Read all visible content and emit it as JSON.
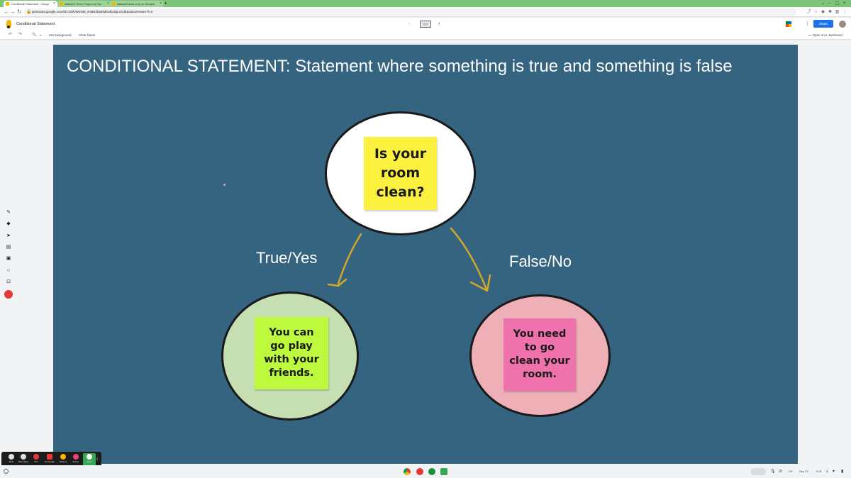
{
  "browser": {
    "tabs": [
      {
        "label": "Conditional Statement - Googl",
        "active": true
      },
      {
        "label": "dallas03 Timer Project on Scr",
        "active": false
      },
      {
        "label": "dallas03 does it fly on Scratch",
        "active": false
      }
    ],
    "new_tab_glyph": "+",
    "url": "jamboard.google.com/d/1-DbfJWmh0l_imkBnfD5EMKMbzDjLsGdEDzBsu/viewer?f=0",
    "nav_icons": [
      "back-icon",
      "forward-icon",
      "reload-icon",
      "lock-icon"
    ]
  },
  "app": {
    "title": "Conditional Statement",
    "share_label": "Share",
    "more_glyph": "⋮",
    "prev_glyph": "‹",
    "next_glyph": "›",
    "toolbar": {
      "undo_glyph": "↶",
      "redo_glyph": "↷",
      "zoom_glyph": "🔍",
      "zoom_caret": "▾",
      "set_background": "Set background",
      "clear_frame": "Clear frame",
      "open_jamboard": "Open on a Jamboard"
    }
  },
  "slide": {
    "heading": "CONDITIONAL STATEMENT: Statement where something is true and something is false",
    "true_label": "True/Yes",
    "false_label": "False/No",
    "question_note": "Is your\nroom\nclean?",
    "true_note": "You can\ngo play\nwith your\nfriends.",
    "false_note": "You need\nto go\nclean your\nroom.",
    "colors": {
      "background": "#34647f",
      "top_circle": "#ffffff",
      "true_circle": "#c5dfb3",
      "false_circle": "#eeb0b6",
      "question_note": "#fdf140",
      "true_note": "#bdf93c",
      "false_note": "#f072ac",
      "arrow": "#d4a62a"
    }
  },
  "tools": [
    "pen-icon",
    "eraser-icon",
    "select-icon",
    "sticky-note-icon",
    "image-icon",
    "shape-icon",
    "text-box-icon",
    "laser-icon"
  ],
  "zoom_controls": [
    {
      "label": "Mute",
      "color": "#e0e0e0"
    },
    {
      "label": "Stop Video",
      "color": "#e0e0e0"
    },
    {
      "label": "Pen",
      "color": "#e53935"
    },
    {
      "label": "Rectangle",
      "color": "#e53935"
    },
    {
      "label": "Stickers",
      "color": "#f4b400"
    },
    {
      "label": "Eraser",
      "color": "#ec407a"
    },
    {
      "label": "More",
      "color": "#ffffff"
    }
  ],
  "shelf": {
    "ime": "US",
    "date": "Sep 23",
    "time": "9:31",
    "apps": [
      {
        "name": "chrome-icon",
        "color": "#db4437"
      },
      {
        "name": "app-red-icon",
        "color": "#e53935"
      },
      {
        "name": "meet-icon",
        "color": "#1e8e3e"
      },
      {
        "name": "app-green-icon",
        "color": "#34a853"
      }
    ]
  }
}
